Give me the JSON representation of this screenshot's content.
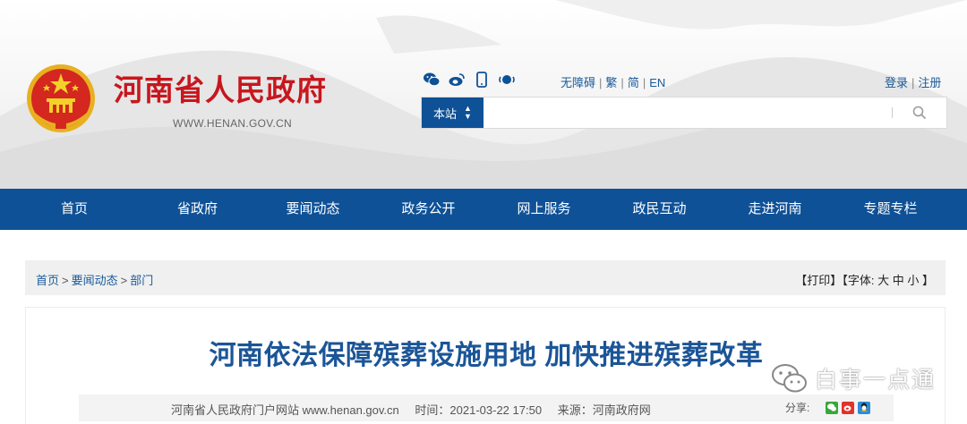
{
  "header": {
    "site_title": "河南省人民政府",
    "site_url": "WWW.HENAN.GOV.CN",
    "social_icons": [
      "wechat-icon",
      "weibo-icon",
      "mobile-icon",
      "audio-icon"
    ],
    "lang_links": [
      "无障碍",
      "繁",
      "简",
      "EN"
    ],
    "auth_links": [
      "登录",
      "注册"
    ],
    "search": {
      "scope_label": "本站",
      "placeholder": ""
    },
    "colors": {
      "brand_red": "#c8161d",
      "brand_blue": "#0f5196"
    }
  },
  "nav": {
    "items": [
      "首页",
      "省政府",
      "要闻动态",
      "政务公开",
      "网上服务",
      "政民互动",
      "走进河南",
      "专题专栏"
    ]
  },
  "breadcrumb": {
    "items": [
      "首页",
      "要闻动态",
      "部门"
    ]
  },
  "tools": {
    "print": "【打印】",
    "font_label": "【字体:",
    "font_large": "大",
    "font_medium": "中",
    "font_small": "小",
    "close": "】"
  },
  "article": {
    "title": "河南依法保障殡葬设施用地 加快推进殡葬改革",
    "meta_source_site": "河南省人民政府门户网站 www.henan.gov.cn",
    "meta_time": "时间：2021-03-22 17:50",
    "meta_origin": "来源：河南政府网",
    "share_label": "分享:"
  },
  "watermark": {
    "text": "白事一点通"
  }
}
